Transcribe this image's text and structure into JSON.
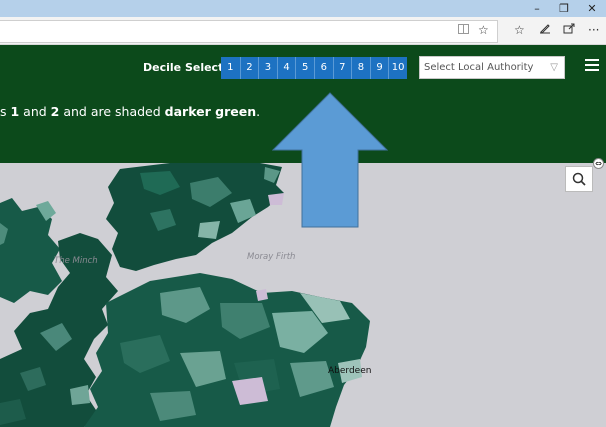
{
  "window": {
    "minimize": "–",
    "restore": "❐",
    "close": "✕"
  },
  "toolbar": {
    "more": "···"
  },
  "header": {
    "decile_label": "Decile Selector",
    "deciles": [
      "1",
      "2",
      "3",
      "4",
      "5",
      "6",
      "7",
      "8",
      "9",
      "10"
    ],
    "la_placeholder": "Select Local Authority",
    "desc_prefix": "s ",
    "desc_n1": "1",
    "desc_and": " and ",
    "desc_n2": "2",
    "desc_mid": " and are shaded ",
    "desc_emph": "darker green",
    "desc_end": "."
  },
  "map": {
    "label_minch": "The Minch",
    "label_moray": "Moray Firth",
    "label_aberdeen": "Aberdeen"
  },
  "colors": {
    "header_bg": "#0c4a1b",
    "decile_bg": "#1d72c2",
    "arrow": "#5b9bd5",
    "land_dark": "#124d3c",
    "sea": "#cfcfd4"
  },
  "icons": [
    "reading-view-icon",
    "favorite-star-icon",
    "favorites-list-icon",
    "pen-icon",
    "share-icon",
    "hamburger-icon",
    "search-icon"
  ]
}
